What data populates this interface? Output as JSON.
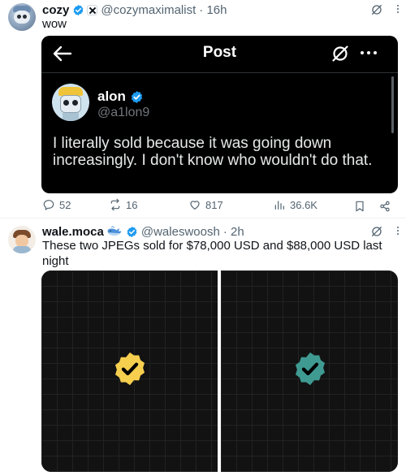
{
  "post1": {
    "name": "cozy",
    "handle": "@cozymaximalist",
    "time": "· 16h",
    "text": "wow",
    "embedded": {
      "header_title": "Post",
      "author_name": "alon",
      "author_handle": "@a1lon9",
      "text": "I literally sold because it was going down increasingly. I don't know who wouldn't do that."
    },
    "actions": {
      "replies": "52",
      "reposts": "16",
      "likes": "817",
      "views": "36.6K"
    }
  },
  "post2": {
    "name": "wale.moca",
    "handle": "@waleswoosh",
    "time": "· 2h",
    "text": "These two JPEGs sold for $78,000 USD and $88,000 USD last night",
    "images": [
      {
        "badge_color": "#f6cf4f",
        "check_color": "#000000"
      },
      {
        "badge_color": "#3f9a92",
        "check_color": "#000000"
      }
    ]
  },
  "colors": {
    "verified_blue": "#1d9bf0",
    "text_primary": "#0f1419",
    "text_secondary": "#536471"
  },
  "icons": [
    "back-arrow-icon",
    "grok-icon",
    "more-icon",
    "verified-badge-icon",
    "reply-icon",
    "repost-icon",
    "like-icon",
    "views-icon",
    "bookmark-icon",
    "share-icon",
    "whale-emoji-icon",
    "affiliate-badge-icon"
  ]
}
